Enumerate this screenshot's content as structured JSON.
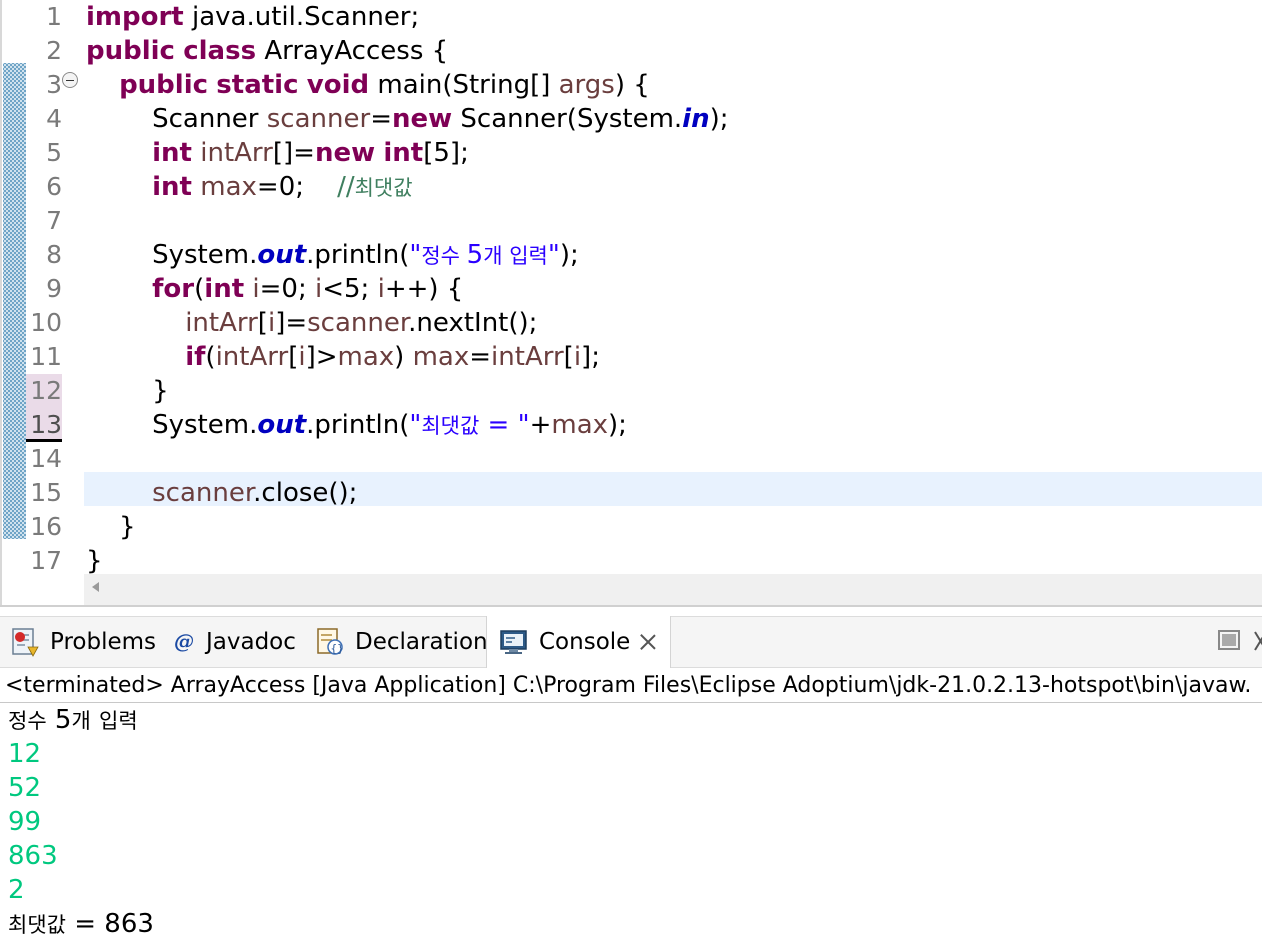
{
  "editor": {
    "line_numbers": [
      "1",
      "2",
      "3",
      "4",
      "5",
      "6",
      "7",
      "8",
      "9",
      "10",
      "11",
      "12",
      "13",
      "14",
      "15",
      "16",
      "17"
    ],
    "lines": [
      [
        {
          "t": "import",
          "c": "kw"
        },
        {
          "t": " java.util.Scanner;"
        }
      ],
      [
        {
          "t": "public",
          "c": "kw"
        },
        {
          "t": " "
        },
        {
          "t": "class",
          "c": "kw"
        },
        {
          "t": " ArrayAccess {"
        }
      ],
      [
        {
          "t": "    "
        },
        {
          "t": "public",
          "c": "kw"
        },
        {
          "t": " "
        },
        {
          "t": "static",
          "c": "kw"
        },
        {
          "t": " "
        },
        {
          "t": "void",
          "c": "kw"
        },
        {
          "t": " main(String[] "
        },
        {
          "t": "args",
          "c": "var"
        },
        {
          "t": ") {"
        }
      ],
      [
        {
          "t": "        Scanner "
        },
        {
          "t": "scanner",
          "c": "var"
        },
        {
          "t": "="
        },
        {
          "t": "new",
          "c": "kw"
        },
        {
          "t": " Scanner(System."
        },
        {
          "t": "in",
          "c": "fld"
        },
        {
          "t": ");"
        }
      ],
      [
        {
          "t": "        "
        },
        {
          "t": "int",
          "c": "kw"
        },
        {
          "t": " "
        },
        {
          "t": "intArr",
          "c": "var"
        },
        {
          "t": "[]="
        },
        {
          "t": "new",
          "c": "kw"
        },
        {
          "t": " "
        },
        {
          "t": "int",
          "c": "kw"
        },
        {
          "t": "[5];"
        }
      ],
      [
        {
          "t": "        "
        },
        {
          "t": "int",
          "c": "kw"
        },
        {
          "t": " "
        },
        {
          "t": "max",
          "c": "var"
        },
        {
          "t": "=0;    "
        },
        {
          "t": "//",
          "c": "cmt"
        },
        {
          "t": "최댓값",
          "c": "cmt kr"
        }
      ],
      [
        {
          "t": ""
        }
      ],
      [
        {
          "t": "        System."
        },
        {
          "t": "out",
          "c": "fld"
        },
        {
          "t": ".println("
        },
        {
          "t": "\"",
          "c": "str"
        },
        {
          "t": "정수 ",
          "c": "str kr"
        },
        {
          "t": "5",
          "c": "str"
        },
        {
          "t": "개 입력",
          "c": "str kr"
        },
        {
          "t": "\"",
          "c": "str"
        },
        {
          "t": ");"
        }
      ],
      [
        {
          "t": "        "
        },
        {
          "t": "for",
          "c": "kw"
        },
        {
          "t": "("
        },
        {
          "t": "int",
          "c": "kw"
        },
        {
          "t": " "
        },
        {
          "t": "i",
          "c": "var"
        },
        {
          "t": "=0; "
        },
        {
          "t": "i",
          "c": "var"
        },
        {
          "t": "<5; "
        },
        {
          "t": "i",
          "c": "var"
        },
        {
          "t": "++) {"
        }
      ],
      [
        {
          "t": "            "
        },
        {
          "t": "intArr",
          "c": "var"
        },
        {
          "t": "["
        },
        {
          "t": "i",
          "c": "var"
        },
        {
          "t": "]="
        },
        {
          "t": "scanner",
          "c": "var"
        },
        {
          "t": ".nextInt();"
        }
      ],
      [
        {
          "t": "            "
        },
        {
          "t": "if",
          "c": "kw"
        },
        {
          "t": "("
        },
        {
          "t": "intArr",
          "c": "var"
        },
        {
          "t": "["
        },
        {
          "t": "i",
          "c": "var"
        },
        {
          "t": "]>"
        },
        {
          "t": "max",
          "c": "var"
        },
        {
          "t": ") "
        },
        {
          "t": "max",
          "c": "var"
        },
        {
          "t": "="
        },
        {
          "t": "intArr",
          "c": "var"
        },
        {
          "t": "["
        },
        {
          "t": "i",
          "c": "var"
        },
        {
          "t": "];"
        }
      ],
      [
        {
          "t": "        }"
        }
      ],
      [
        {
          "t": "        System."
        },
        {
          "t": "out",
          "c": "fld"
        },
        {
          "t": ".println("
        },
        {
          "t": "\"",
          "c": "str"
        },
        {
          "t": "최댓값",
          "c": "str kr"
        },
        {
          "t": " = \"",
          "c": "str"
        },
        {
          "t": "+"
        },
        {
          "t": "max",
          "c": "var"
        },
        {
          "t": ");"
        }
      ],
      [
        {
          "t": ""
        }
      ],
      [
        {
          "t": "        "
        },
        {
          "t": "scanner",
          "c": "var"
        },
        {
          "t": ".close();"
        }
      ],
      [
        {
          "t": "    }"
        }
      ],
      [
        {
          "t": "}"
        }
      ]
    ]
  },
  "tabs": {
    "problems": "Problems",
    "javadoc": "Javadoc",
    "declaration": "Declaration",
    "console": "Console"
  },
  "console": {
    "description": "<terminated> ArrayAccess [Java Application] C:\\Program Files\\Eclipse Adoptium\\jdk-21.0.2.13-hotspot\\bin\\javaw.",
    "output": [
      {
        "text": "정수 5개 입력",
        "kind": "sys"
      },
      {
        "text": "12",
        "kind": "in"
      },
      {
        "text": "52",
        "kind": "in"
      },
      {
        "text": "99",
        "kind": "in"
      },
      {
        "text": "863",
        "kind": "in"
      },
      {
        "text": "2",
        "kind": "in"
      },
      {
        "text": "최댓값 = 863",
        "kind": "sys"
      }
    ]
  },
  "colors": {
    "keyword": "#7f0055",
    "variable": "#6a3e3e",
    "static_field": "#0000c0",
    "string": "#2a00ff",
    "comment": "#3f7f5f",
    "console_input": "#00c87f",
    "current_line": "#e8f2fe"
  },
  "icons": [
    "problems-icon",
    "javadoc-at-icon",
    "declaration-icon",
    "console-icon",
    "close-icon",
    "minimize-icon",
    "maximize-icon",
    "fold-collapse-icon"
  ]
}
